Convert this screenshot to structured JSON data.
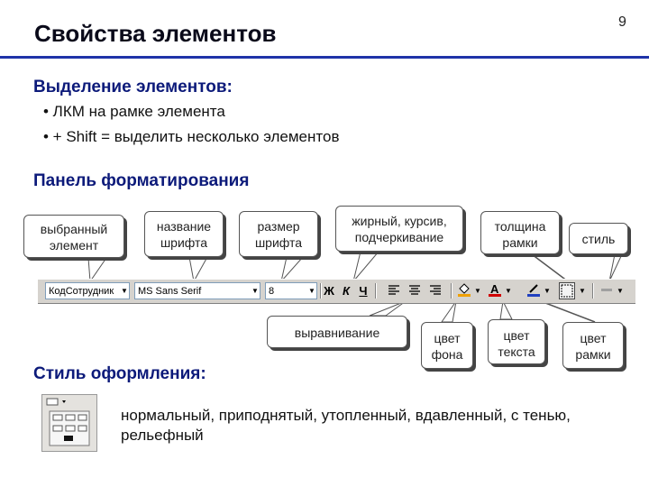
{
  "page": {
    "title": "Свойства элементов",
    "number": "9"
  },
  "selection": {
    "heading": "Выделение элементов:",
    "bullets": [
      "• ЛКМ на рамке элемента",
      "• + Shift = выделить несколько элементов"
    ]
  },
  "format_panel": {
    "heading": "Панель форматирования",
    "callouts": {
      "selected_element": "выбранный элемент",
      "font_name": "название шрифта",
      "font_size": "размер шрифта",
      "bold_italic_underline": "жирный, курсив, подчеркивание",
      "border_width": "толщина рамки",
      "style": "стиль",
      "alignment": "выравнивание",
      "bg_color": "цвет фона",
      "text_color": "цвет текста",
      "border_color": "цвет рамки"
    },
    "toolbar": {
      "object_value": "КодСотрудник",
      "font_value": "MS Sans Serif",
      "size_value": "8",
      "bold": "Ж",
      "italic": "К",
      "underline": "Ч",
      "font_color_glyph": "A",
      "accent_bg": "#f0a000",
      "accent_text": "#d00000",
      "accent_line": "#2040c0"
    }
  },
  "appearance": {
    "heading": "Стиль оформления:",
    "text": "нормальный, приподнятый, утопленный, вдавленный, с тенью, рельефный"
  }
}
